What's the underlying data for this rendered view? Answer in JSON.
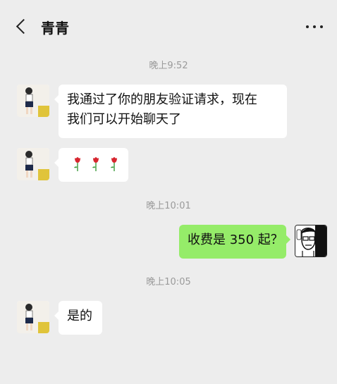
{
  "header": {
    "contact_name": "青青"
  },
  "messages": [
    {
      "type": "time",
      "text": "晚上9:52"
    },
    {
      "type": "in",
      "text": "我通过了你的朋友验证请求，现在我们可以开始聊天了",
      "line1": "我通过了你的朋友验证请求，现在",
      "line2": "我们可以开始聊天了"
    },
    {
      "type": "in",
      "icons": [
        "rose-icon",
        "rose-icon",
        "rose-icon"
      ]
    },
    {
      "type": "time",
      "text": "晚上10:01"
    },
    {
      "type": "out",
      "text": "收费是 350 起？"
    },
    {
      "type": "time",
      "text": "晚上10:05"
    },
    {
      "type": "in",
      "text": "是的"
    }
  ],
  "colors": {
    "background": "#ededed",
    "incoming_bubble": "#ffffff",
    "outgoing_bubble": "#95ec69",
    "timestamp": "#9a9a9a"
  }
}
